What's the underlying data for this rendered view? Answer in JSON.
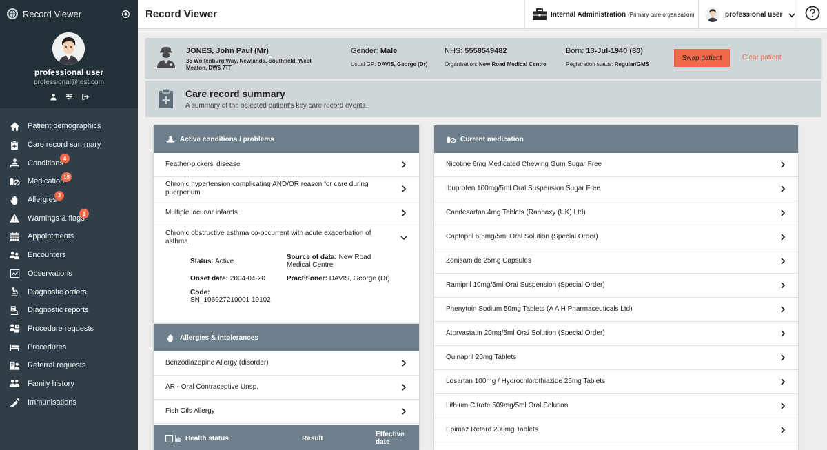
{
  "app": {
    "title": "Record Viewer"
  },
  "user": {
    "name": "professional user",
    "email": "professional@test.com"
  },
  "nav": [
    {
      "label": "Patient demographics",
      "icon": "home-icon",
      "badge": ""
    },
    {
      "label": "Care record summary",
      "icon": "clipboard-plus-icon",
      "badge": ""
    },
    {
      "label": "Conditions",
      "icon": "patient-bed-icon",
      "badge": "4"
    },
    {
      "label": "Medication",
      "icon": "pills-icon",
      "badge": "15"
    },
    {
      "label": "Allergies",
      "icon": "hand-icon",
      "badge": "3"
    },
    {
      "label": "Warnings & flags",
      "icon": "warning-icon",
      "badge": "1"
    },
    {
      "label": "Appointments",
      "icon": "calendar-icon",
      "badge": ""
    },
    {
      "label": "Encounters",
      "icon": "people-icon",
      "badge": ""
    },
    {
      "label": "Observations",
      "icon": "chart-icon",
      "badge": ""
    },
    {
      "label": "Diagnostic orders",
      "icon": "microscope-icon",
      "badge": ""
    },
    {
      "label": "Diagnostic reports",
      "icon": "report-icon",
      "badge": ""
    },
    {
      "label": "Procedure requests",
      "icon": "procedure-request-icon",
      "badge": ""
    },
    {
      "label": "Procedures",
      "icon": "procedure-bed-icon",
      "badge": ""
    },
    {
      "label": "Referral requests",
      "icon": "referral-icon",
      "badge": ""
    },
    {
      "label": "Family history",
      "icon": "family-icon",
      "badge": ""
    },
    {
      "label": "Immunisations",
      "icon": "syringe-icon",
      "badge": ""
    }
  ],
  "topbar": {
    "title": "Record Viewer",
    "org_name": "Internal Administration",
    "org_type": "(Primary care organisation)",
    "user_label": "professional user"
  },
  "patient": {
    "name": "JONES, John Paul (Mr)",
    "address": "35 Wolfenburg Way, Newlands, Southfield, West Meaton, DW6 7TF",
    "gender_label": "Gender:",
    "gender": "Male",
    "gp_label": "Usual GP:",
    "gp": "DAVIS, George (Dr)",
    "nhs_label": "NHS:",
    "nhs": "5558549482",
    "org_label": "Organisation:",
    "org": "New Road Medical Centre",
    "born_label": "Born:",
    "born": "13-Jul-1940 (80)",
    "reg_label": "Registration status:",
    "reg": "Regular/GMS",
    "swap_label": "Swap patient",
    "clear_label": "Clear patient"
  },
  "summary": {
    "title": "Care record summary",
    "subtitle": "A summary of the selected patient's key care record events."
  },
  "conditions": {
    "title": "Active conditions / problems",
    "items": [
      "Feather-pickers' disease",
      "Chronic hypertension complicating AND/OR reason for care during puerperium",
      "Multiple lacunar infarcts",
      "Chronic obstructive asthma co-occurrent with acute exacerbation of asthma"
    ],
    "detail": {
      "status_label": "Status:",
      "status": "Active",
      "source_label": "Source of data:",
      "source": "New Road Medical Centre",
      "onset_label": "Onset date:",
      "onset": "2004-04-20",
      "practitioner_label": "Practitioner:",
      "practitioner": "DAVIS, George (Dr)",
      "code_label": "Code:",
      "code": "SN_106927210001 19102"
    }
  },
  "allergies": {
    "title": "Allergies & intolerances",
    "items": [
      "Benzodiazepine Allergy (disorder)",
      "AR - Oral Contraceptive Unsp.",
      "Fish Oils Allergy"
    ]
  },
  "health": {
    "title": "Health status",
    "result": "Result",
    "effective": "Effective date"
  },
  "medication": {
    "title": "Current medication",
    "items": [
      "Nicotine 6mg Medicated Chewing Gum Sugar Free",
      "Ibuprofen 100mg/5ml Oral Suspension Sugar Free",
      "Candesartan 4mg Tablets (Ranbaxy (UK) Ltd)",
      "Captopril 6.5mg/5ml Oral Solution (Special Order)",
      "Zonisamide 25mg Capsules",
      "Ramipril 10mg/5ml Oral Suspension (Special Order)",
      "Phenytoin Sodium 50mg Tablets (A A H Pharmaceuticals Ltd)",
      "Atorvastatin 20mg/5ml Oral Solution (Special Order)",
      "Quinapril 20mg Tablets",
      "Losartan 100mg / Hydrochlorothiazide 25mg Tablets",
      "Lithium Citrate 509mg/5ml Oral Solution",
      "Epimaz Retard 200mg Tablets"
    ]
  },
  "colors": {
    "sidebar": "#2f3e48",
    "accent": "#f0694a",
    "panel_header": "#6d7f8a",
    "patient_banner": "#cfd6d9"
  }
}
